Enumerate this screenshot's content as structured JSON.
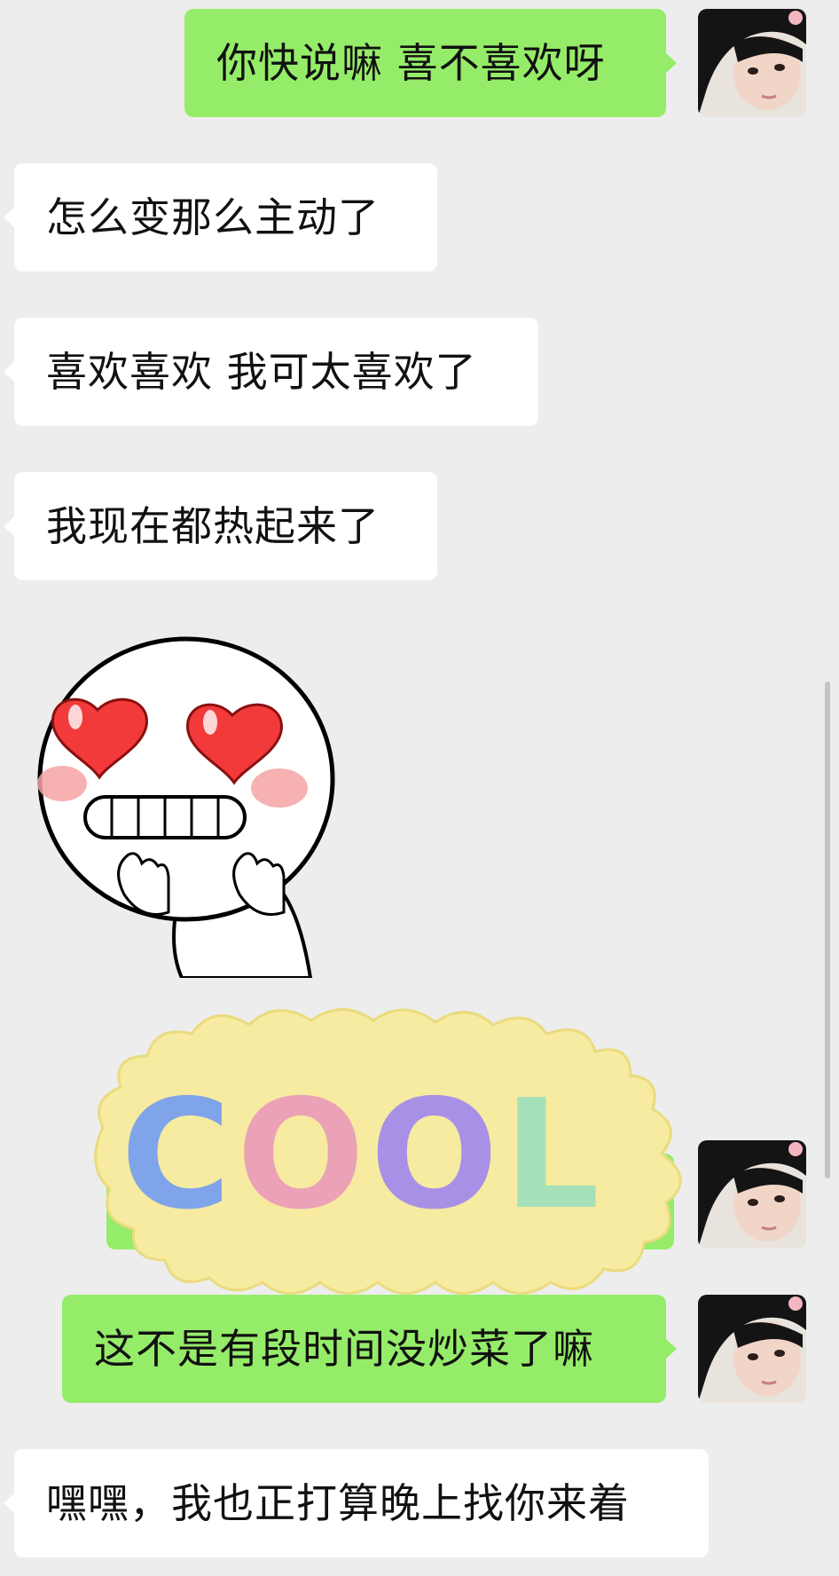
{
  "messages": [
    {
      "side": "sent",
      "text": "你快说嘛 喜不喜欢呀"
    },
    {
      "side": "recv",
      "text": "怎么变那么主动了"
    },
    {
      "side": "recv",
      "text": "喜欢喜欢 我可太喜欢了"
    },
    {
      "side": "recv",
      "text": "我现在都热起来了"
    },
    {
      "side": "recv",
      "sticker": "heart-eyes-stickman-sticker"
    },
    {
      "side": "sent",
      "sticker": "cool-clay-sticker",
      "sticker_text": "COOL"
    },
    {
      "side": "sent",
      "text": "这不是有段时间没炒菜了嘛"
    },
    {
      "side": "recv",
      "text": "嘿嘿，我也正打算晚上找你来着"
    }
  ],
  "colors": {
    "background": "#ededed",
    "sent_bubble": "#95ec69",
    "recv_bubble": "#ffffff"
  }
}
